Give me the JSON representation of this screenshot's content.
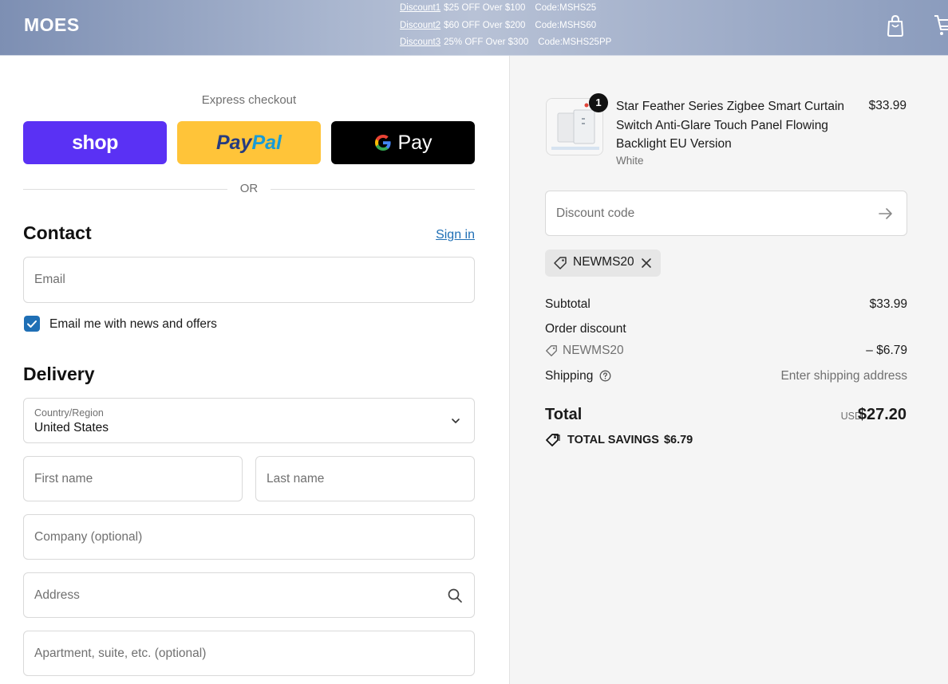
{
  "header": {
    "logo": "MOES",
    "promotions": [
      {
        "label": "Discount1",
        "text": "$25 OFF Over $100",
        "code": "Code:MSHS25"
      },
      {
        "label": "Discount2",
        "text": "$60 OFF Over $200",
        "code": "Code:MSHS60"
      },
      {
        "label": "Discount3",
        "text": "25% OFF Over $300",
        "code": "Code:MSHS25PP"
      }
    ],
    "icons": [
      "bag-icon",
      "cart-icon"
    ]
  },
  "express": {
    "title": "Express checkout",
    "shop_label": "shop",
    "paypal_label_1": "Pay",
    "paypal_label_2": "Pal",
    "gpay_label": "Pay",
    "or_label": "OR"
  },
  "contact": {
    "title": "Contact",
    "sign_in": "Sign in",
    "email_placeholder": "Email",
    "newsletter_label": "Email me with news and offers",
    "newsletter_checked": true
  },
  "delivery": {
    "title": "Delivery",
    "country_label": "Country/Region",
    "country_value": "United States",
    "first_name_placeholder": "First name",
    "last_name_placeholder": "Last name",
    "company_placeholder": "Company (optional)",
    "address_placeholder": "Address",
    "apartment_placeholder": "Apartment, suite, etc. (optional)"
  },
  "summary": {
    "product": {
      "quantity": "1",
      "name": "Star Feather Series Zigbee Smart Curtain Switch Anti-Glare Touch Panel Flowing Backlight EU Version",
      "variant": "White",
      "price": "$33.99"
    },
    "discount_placeholder": "Discount code",
    "applied_code": "NEWMS20",
    "subtotal_label": "Subtotal",
    "subtotal_value": "$33.99",
    "order_discount_label": "Order discount",
    "order_discount_code": "NEWMS20",
    "order_discount_value": "– $6.79",
    "shipping_label": "Shipping",
    "shipping_value": "Enter shipping address",
    "total_label": "Total",
    "total_currency": "USD",
    "total_value": "$27.20",
    "savings_label": "TOTAL SAVINGS",
    "savings_value": "$6.79"
  },
  "colors": {
    "shop": "#5a31f4",
    "paypal": "#ffc439",
    "gpay": "#000000",
    "link": "#1f6fb5",
    "summary_bg": "#f5f5f5"
  }
}
